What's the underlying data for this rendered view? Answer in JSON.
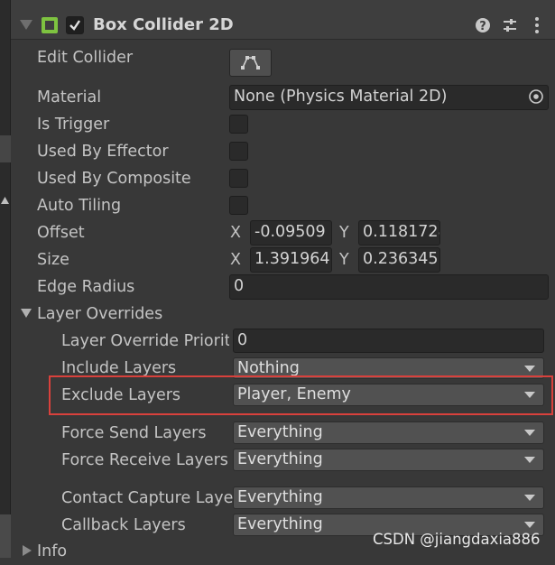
{
  "component": {
    "title": "Box Collider 2D",
    "enabled_checked": true
  },
  "icons": {
    "collapse": "triangle-down-icon",
    "component": "box-collider-icon",
    "help": "help-icon",
    "presets": "presets-icon",
    "menu": "kebab-menu-icon",
    "edit_collider": "edit-polygon-icon",
    "object_picker": "object-picker-icon"
  },
  "fields": {
    "edit_collider_label": "Edit Collider",
    "material_label": "Material",
    "material_value": "None (Physics Material 2D)",
    "is_trigger_label": "Is Trigger",
    "used_by_effector_label": "Used By Effector",
    "used_by_composite_label": "Used By Composite",
    "auto_tiling_label": "Auto Tiling",
    "offset_label": "Offset",
    "offset_x_axis": "X",
    "offset_x": "-0.09509",
    "offset_y_axis": "Y",
    "offset_y": "0.1181728",
    "size_label": "Size",
    "size_x_axis": "X",
    "size_x": "1.391964",
    "size_y_axis": "Y",
    "size_y": "0.236345",
    "edge_radius_label": "Edge Radius",
    "edge_radius_value": "0"
  },
  "layer_overrides": {
    "label": "Layer Overrides",
    "priority_label": "Layer Override Priorit",
    "priority_value": "0",
    "include_label": "Include Layers",
    "include_value": "Nothing",
    "exclude_label": "Exclude Layers",
    "exclude_value": "Player, Enemy",
    "force_send_label": "Force Send Layers",
    "force_send_value": "Everything",
    "force_receive_label": "Force Receive Layers",
    "force_receive_value": "Everything",
    "contact_capture_label": "Contact Capture Laye",
    "contact_capture_value": "Everything",
    "callback_label": "Callback Layers",
    "callback_value": "Everything"
  },
  "info": {
    "label": "Info"
  },
  "watermark": "CSDN @jiangdaxia886",
  "colors": {
    "highlight_border": "#d9413c",
    "component_icon": "#7ec340"
  }
}
